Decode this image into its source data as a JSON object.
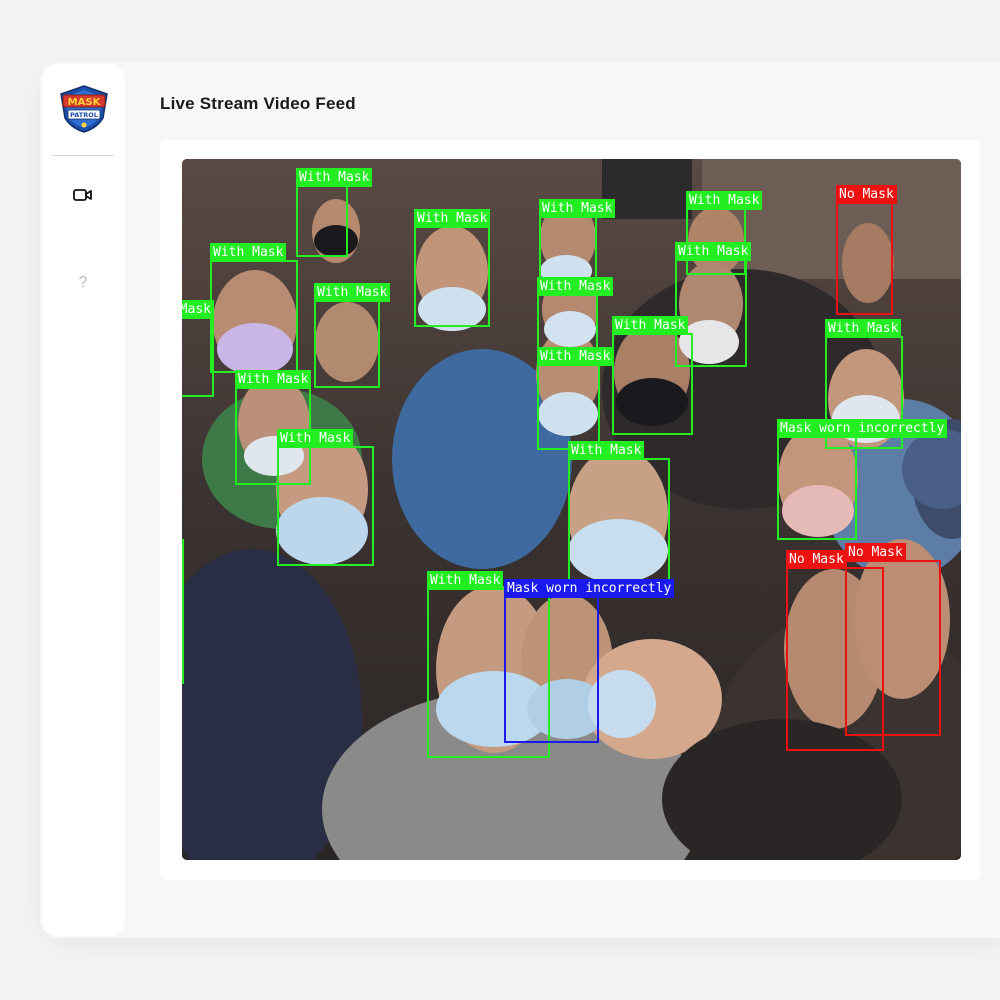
{
  "app": {
    "logo_alt": "Mask Patrol logo"
  },
  "sidebar": {
    "items": [
      {
        "name": "video",
        "icon": "video-camera-icon"
      },
      {
        "name": "help",
        "icon": "help-icon",
        "glyph": "?"
      }
    ]
  },
  "main": {
    "title": "Live Stream Video Feed"
  },
  "colors": {
    "with_mask": "#22ee22",
    "no_mask": "#ee1111",
    "incorrect": "#1a1aee",
    "label_text": "#ffffff"
  },
  "detections": [
    {
      "label": "With Mask",
      "class": "with_mask"
    },
    {
      "label": "With Mask",
      "class": "with_mask"
    },
    {
      "label": "With Mask",
      "class": "with_mask"
    },
    {
      "label": "With Mask",
      "class": "with_mask"
    },
    {
      "label": "No Mask",
      "class": "no_mask"
    },
    {
      "label": "With Mask",
      "class": "with_mask"
    },
    {
      "label": "With Mask",
      "class": "with_mask"
    },
    {
      "label": "With Mask",
      "class": "with_mask"
    },
    {
      "label": "With Mask",
      "class": "with_mask"
    },
    {
      "label": "With Mask",
      "class": "with_mask"
    },
    {
      "label": "With Mask",
      "class": "with_mask"
    },
    {
      "label": "With Mask",
      "class": "with_mask"
    },
    {
      "label": "With Mask",
      "class": "with_mask"
    },
    {
      "label": "With Mask",
      "class": "with_mask"
    },
    {
      "label": "With Mask",
      "class": "with_mask"
    },
    {
      "label": "With Mask",
      "class": "with_mask"
    },
    {
      "label": "Mask worn incorrectly",
      "class": "incorrect"
    },
    {
      "label": "No Mask",
      "class": "no_mask"
    },
    {
      "label": "No Mask",
      "class": "no_mask"
    }
  ]
}
